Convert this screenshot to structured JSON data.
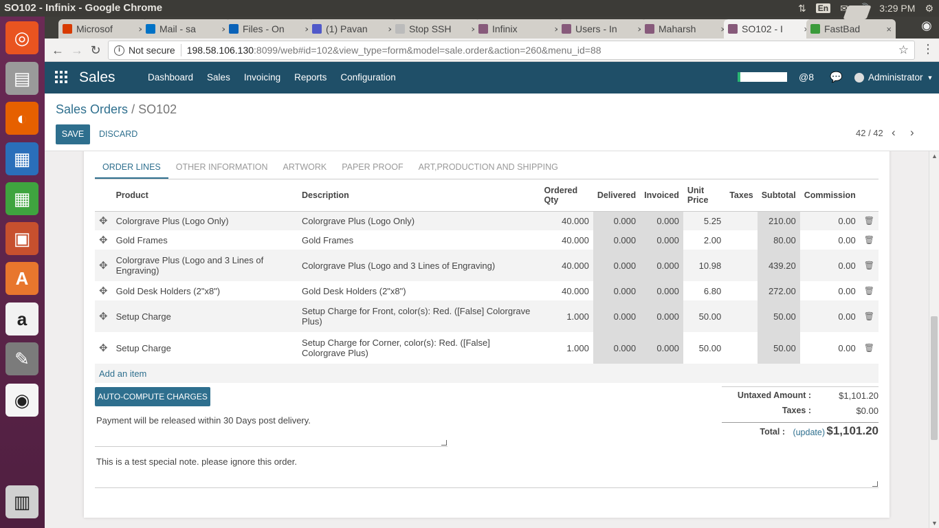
{
  "system_bar": {
    "window_title": "SO102 - Infinix - Google Chrome",
    "keyboard": "En",
    "time": "3:29 PM"
  },
  "launcher": {
    "items": [
      {
        "name": "ubuntu-icon",
        "color": "#e95420"
      },
      {
        "name": "files-icon",
        "color": "#9a9a9a"
      },
      {
        "name": "firefox-icon",
        "color": "#e66000"
      },
      {
        "name": "writer-icon",
        "color": "#2a6fba"
      },
      {
        "name": "calc-icon",
        "color": "#3fa43f"
      },
      {
        "name": "impress-icon",
        "color": "#c7502e"
      },
      {
        "name": "software-center-icon",
        "color": "#e8762d"
      },
      {
        "name": "amazon-icon",
        "color": "#f2f2f2"
      },
      {
        "name": "settings-icon",
        "color": "#7b7b7b"
      },
      {
        "name": "chrome-icon",
        "color": "#f5f5f5"
      },
      {
        "name": "trash-icon",
        "color": "#d0d0d0"
      }
    ]
  },
  "browser": {
    "tabs": [
      {
        "title": "Microsof",
        "favicon": "office-icon",
        "color": "#d83b01"
      },
      {
        "title": "Mail - sa",
        "favicon": "outlook-icon",
        "color": "#0072c6"
      },
      {
        "title": "Files - On",
        "favicon": "onedrive-icon",
        "color": "#0a62b8"
      },
      {
        "title": "(1) Pavan",
        "favicon": "teams-icon",
        "color": "#5059c9"
      },
      {
        "title": "Stop SSH",
        "favicon": "page-icon",
        "color": "#bbbbbb"
      },
      {
        "title": "Infinix",
        "favicon": "odoo-icon",
        "color": "#875a7b"
      },
      {
        "title": "Users - In",
        "favicon": "odoo-icon",
        "color": "#875a7b"
      },
      {
        "title": "Maharsh",
        "favicon": "odoo-icon",
        "color": "#875a7b"
      },
      {
        "title": "SO102 - I",
        "favicon": "odoo-icon",
        "color": "#875a7b",
        "active": true
      },
      {
        "title": "FastBad",
        "favicon": "fastbadge-icon",
        "color": "#3a9b3a"
      }
    ],
    "tab_close": "×",
    "security": "Not secure",
    "url_host": "198.58.106.130",
    "url_path": ":8099/web#id=102&view_type=form&model=sale.order&action=260&menu_id=88"
  },
  "app": {
    "brand": "Sales",
    "menu": [
      "Dashboard",
      "Sales",
      "Invoicing",
      "Reports",
      "Configuration"
    ],
    "activity": "@8",
    "user": "Administrator"
  },
  "control_panel": {
    "breadcrumb_parent": "Sales Orders",
    "breadcrumb_sep": "/",
    "breadcrumb_current": "SO102",
    "save": "SAVE",
    "discard": "DISCARD",
    "pager": "42 / 42"
  },
  "notebook": {
    "tabs": [
      "ORDER LINES",
      "OTHER INFORMATION",
      "ARTWORK",
      "PAPER PROOF",
      "ART,PRODUCTION AND SHIPPING"
    ],
    "active": 0
  },
  "order_lines": {
    "columns": [
      "Product",
      "Description",
      "Ordered Qty",
      "Delivered",
      "Invoiced",
      "Unit Price",
      "Taxes",
      "Subtotal",
      "Commission"
    ],
    "rows": [
      {
        "product": "Colorgrave Plus (Logo Only)",
        "description": "Colorgrave Plus (Logo Only)",
        "qty": "40.000",
        "delivered": "0.000",
        "invoiced": "0.000",
        "price": "5.25",
        "taxes": "",
        "subtotal": "210.00",
        "commission": "0.00"
      },
      {
        "product": "Gold Frames",
        "description": "Gold Frames",
        "qty": "40.000",
        "delivered": "0.000",
        "invoiced": "0.000",
        "price": "2.00",
        "taxes": "",
        "subtotal": "80.00",
        "commission": "0.00"
      },
      {
        "product": "Colorgrave Plus (Logo and 3 Lines of Engraving)",
        "description": "Colorgrave Plus (Logo and 3 Lines of Engraving)",
        "qty": "40.000",
        "delivered": "0.000",
        "invoiced": "0.000",
        "price": "10.98",
        "taxes": "",
        "subtotal": "439.20",
        "commission": "0.00"
      },
      {
        "product": "Gold Desk Holders (2\"x8\")",
        "description": "Gold Desk Holders (2\"x8\")",
        "qty": "40.000",
        "delivered": "0.000",
        "invoiced": "0.000",
        "price": "6.80",
        "taxes": "",
        "subtotal": "272.00",
        "commission": "0.00"
      },
      {
        "product": "Setup Charge",
        "description": "Setup Charge for Front, color(s): Red. ([False] Colorgrave Plus)",
        "qty": "1.000",
        "delivered": "0.000",
        "invoiced": "0.000",
        "price": "50.00",
        "taxes": "",
        "subtotal": "50.00",
        "commission": "0.00"
      },
      {
        "product": "Setup Charge",
        "description": "Setup Charge for Corner, color(s): Red. ([False] Colorgrave Plus)",
        "qty": "1.000",
        "delivered": "0.000",
        "invoiced": "0.000",
        "price": "50.00",
        "taxes": "",
        "subtotal": "50.00",
        "commission": "0.00"
      }
    ],
    "add_item": "Add an item"
  },
  "auto_compute": "AUTO-COMPUTE CHARGES",
  "notes": {
    "payment_terms": "Payment will be released within 30 Days post delivery.",
    "special_note": "This is a test special note. please ignore this order."
  },
  "totals": {
    "untaxed_label": "Untaxed Amount :",
    "untaxed_value": "$1,101.20",
    "taxes_label": "Taxes :",
    "taxes_value": "$0.00",
    "total_label": "Total :",
    "update": "(update)",
    "total_value": "$1,101.20"
  }
}
